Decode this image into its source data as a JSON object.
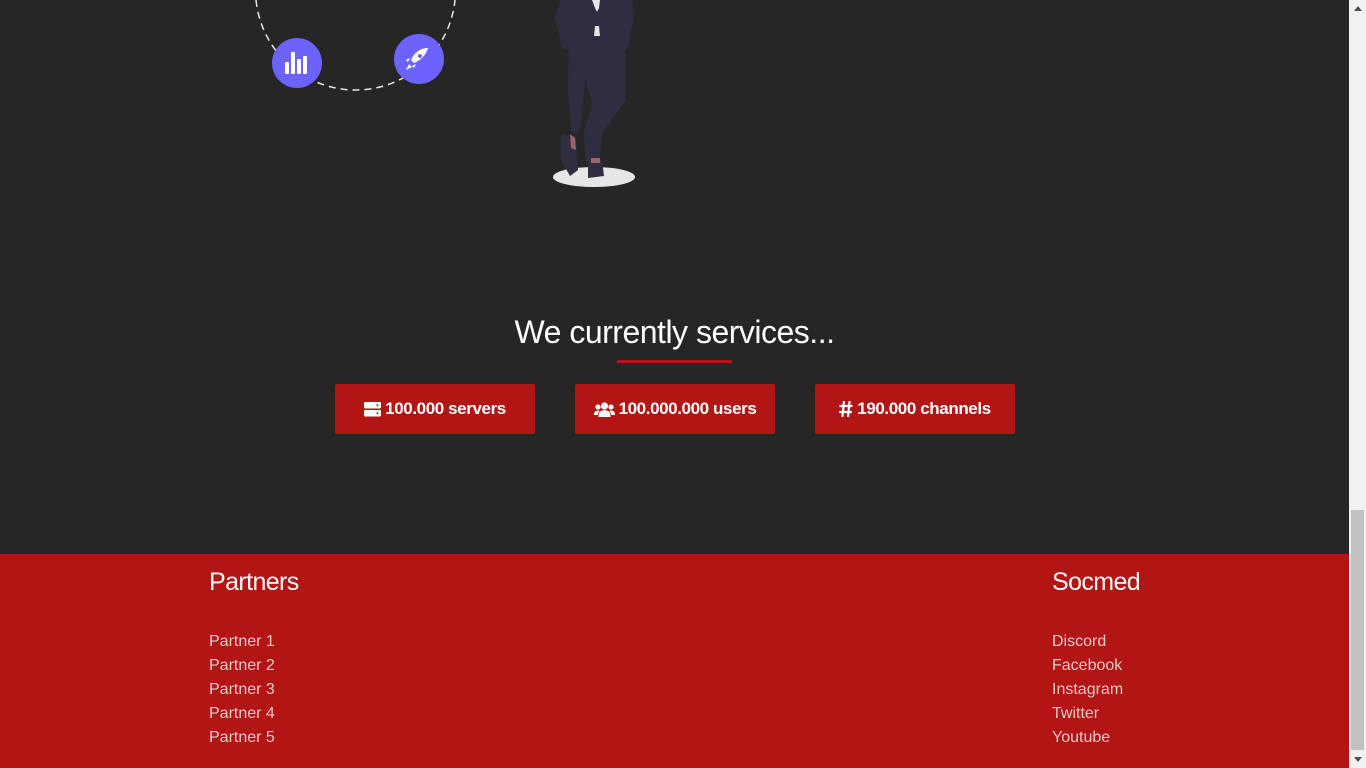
{
  "services": {
    "title": "We currently services...",
    "stats": [
      {
        "icon": "server-icon",
        "label": "100.000 servers"
      },
      {
        "icon": "users-icon",
        "label": "100.000.000 users"
      },
      {
        "icon": "hashtag-icon",
        "label": "190.000 channels"
      }
    ]
  },
  "footer": {
    "partners": {
      "heading": "Partners",
      "items": [
        "Partner 1",
        "Partner 2",
        "Partner 3",
        "Partner 4",
        "Partner 5"
      ]
    },
    "socmed": {
      "heading": "Socmed",
      "items": [
        "Discord",
        "Facebook",
        "Instagram",
        "Twitter",
        "Youtube"
      ]
    }
  },
  "colors": {
    "background": "#262626",
    "accent": "#b31414",
    "icon_circle": "#6c63ff"
  }
}
